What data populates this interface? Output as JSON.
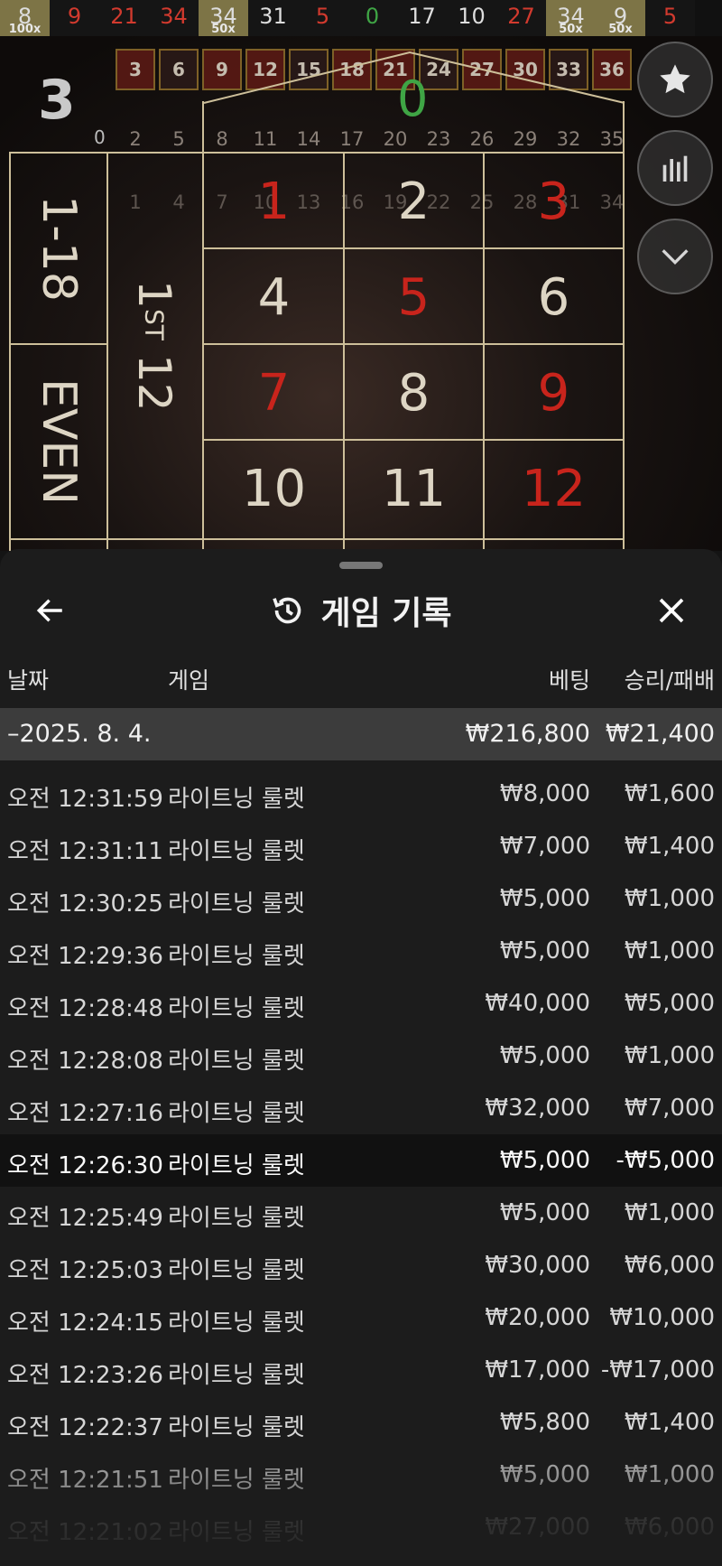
{
  "results": [
    {
      "n": "8",
      "color": "white",
      "mult": "100x"
    },
    {
      "n": "9",
      "color": "red",
      "mult": ""
    },
    {
      "n": "21",
      "color": "red",
      "mult": ""
    },
    {
      "n": "34",
      "color": "red",
      "mult": ""
    },
    {
      "n": "34",
      "color": "white",
      "mult": "50x"
    },
    {
      "n": "31",
      "color": "white",
      "mult": ""
    },
    {
      "n": "5",
      "color": "red",
      "mult": ""
    },
    {
      "n": "0",
      "color": "green",
      "mult": ""
    },
    {
      "n": "17",
      "color": "white",
      "mult": ""
    },
    {
      "n": "10",
      "color": "white",
      "mult": ""
    },
    {
      "n": "27",
      "color": "red",
      "mult": ""
    },
    {
      "n": "34",
      "color": "white",
      "mult": "50x"
    },
    {
      "n": "9",
      "color": "white",
      "mult": "50x"
    },
    {
      "n": "5",
      "color": "red",
      "mult": ""
    }
  ],
  "game": {
    "last_number": "3",
    "zero": "0",
    "small_zero": "0",
    "bg_top_row": [
      "3",
      "6",
      "9",
      "12",
      "15",
      "18",
      "21",
      "24",
      "27",
      "30",
      "33",
      "36"
    ],
    "bg_mid_row": [
      "2",
      "5",
      "8",
      "11",
      "14",
      "17",
      "20",
      "23",
      "26",
      "29",
      "32",
      "35"
    ],
    "bg_low_row": [
      "1",
      "4",
      "7",
      "10",
      "13",
      "16",
      "19",
      "22",
      "25",
      "28",
      "31",
      "34"
    ],
    "outside_low": "1-18",
    "outside_even": "EVEN",
    "dozen_num": "1",
    "dozen_suffix": "ST",
    "dozen_tail": "12",
    "numbers": [
      "1",
      "2",
      "3",
      "4",
      "5",
      "6",
      "7",
      "8",
      "9",
      "10",
      "11",
      "12"
    ]
  },
  "colors": {
    "red": "#c8241c",
    "green": "#3fa545",
    "gold": "#cdbf9a"
  },
  "icons": [
    "star-icon",
    "statistics-icon",
    "chevron-down-icon",
    "back-arrow-icon",
    "history-icon",
    "close-icon"
  ],
  "panel": {
    "title": "게임 기록",
    "headers": {
      "date": "날짜",
      "game": "게임",
      "bet": "베팅",
      "winloss": "승리/패배"
    },
    "date_group": {
      "date": "–2025. 8. 4.",
      "bet_total": "₩216,800",
      "win_total": "₩21,400"
    },
    "rows": [
      {
        "time": "오전 12:31:59",
        "game": "라이트닝 룰렛",
        "bet": "₩8,000",
        "win": "₩1,600"
      },
      {
        "time": "오전 12:31:11",
        "game": "라이트닝 룰렛",
        "bet": "₩7,000",
        "win": "₩1,400"
      },
      {
        "time": "오전 12:30:25",
        "game": "라이트닝 룰렛",
        "bet": "₩5,000",
        "win": "₩1,000"
      },
      {
        "time": "오전 12:29:36",
        "game": "라이트닝 룰렛",
        "bet": "₩5,000",
        "win": "₩1,000"
      },
      {
        "time": "오전 12:28:48",
        "game": "라이트닝 룰렛",
        "bet": "₩40,000",
        "win": "₩5,000"
      },
      {
        "time": "오전 12:28:08",
        "game": "라이트닝 룰렛",
        "bet": "₩5,000",
        "win": "₩1,000"
      },
      {
        "time": "오전 12:27:16",
        "game": "라이트닝 룰렛",
        "bet": "₩32,000",
        "win": "₩7,000"
      },
      {
        "time": "오전 12:26:30",
        "game": "라이트닝 룰렛",
        "bet": "₩5,000",
        "win": "-₩5,000"
      },
      {
        "time": "오전 12:25:49",
        "game": "라이트닝 룰렛",
        "bet": "₩5,000",
        "win": "₩1,000"
      },
      {
        "time": "오전 12:25:03",
        "game": "라이트닝 룰렛",
        "bet": "₩30,000",
        "win": "₩6,000"
      },
      {
        "time": "오전 12:24:15",
        "game": "라이트닝 룰렛",
        "bet": "₩20,000",
        "win": "₩10,000"
      },
      {
        "time": "오전 12:23:26",
        "game": "라이트닝 룰렛",
        "bet": "₩17,000",
        "win": "-₩17,000"
      },
      {
        "time": "오전 12:22:37",
        "game": "라이트닝 룰렛",
        "bet": "₩5,800",
        "win": "₩1,400"
      },
      {
        "time": "오전 12:21:51",
        "game": "라이트닝 룰렛",
        "bet": "₩5,000",
        "win": "₩1,000"
      },
      {
        "time": "오전 12:21:02",
        "game": "라이트닝 룰렛",
        "bet": "₩27,000",
        "win": "₩6,000"
      }
    ]
  }
}
